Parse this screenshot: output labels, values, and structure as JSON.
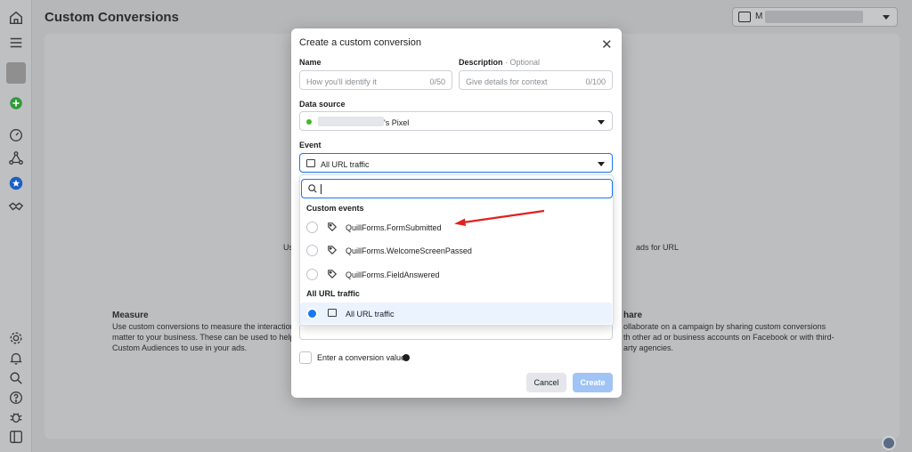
{
  "page": {
    "title": "Custom Conversions",
    "account_initial": "M"
  },
  "modal": {
    "title": "Create a custom conversion",
    "name_label": "Name",
    "name_placeholder": "How you'll identify it",
    "name_counter": "0/50",
    "desc_label": "Description",
    "desc_optional": "· Optional",
    "desc_placeholder": "Give details for context",
    "desc_counter": "0/100",
    "source_label": "Data source",
    "source_value": "'s Pixel",
    "event_label": "Event",
    "event_value": "All URL traffic",
    "conversion_value_label": "Enter a conversion value",
    "cancel": "Cancel",
    "create": "Create"
  },
  "dropdown": {
    "search_value": "",
    "sections": [
      {
        "title": "Custom events",
        "items": [
          "QuillForms.FormSubmitted",
          "QuillForms.WelcomeScreenPassed",
          "QuillForms.FieldAnswered"
        ]
      },
      {
        "title": "All URL traffic",
        "items": [
          "All URL traffic"
        ]
      }
    ]
  },
  "background": {
    "measure_title": "Measure",
    "measure_text_1": "Use custom conversions to measure the interaction",
    "measure_text_2": "matter to your business. These can be used to help c",
    "measure_text_3": "Custom Audiences to use in your ads.",
    "share_title": "hare",
    "share_text_1": "ollaborate on a campaign by sharing custom conversions",
    "share_text_2": "th other ad or business accounts on Facebook or with third-",
    "share_text_3": "arty agencies.",
    "frag_left": "Us",
    "frag_right": "ads for URL"
  },
  "colors": {
    "accent": "#1877f2",
    "green": "#42b72a",
    "arrow": "#e0211f"
  }
}
